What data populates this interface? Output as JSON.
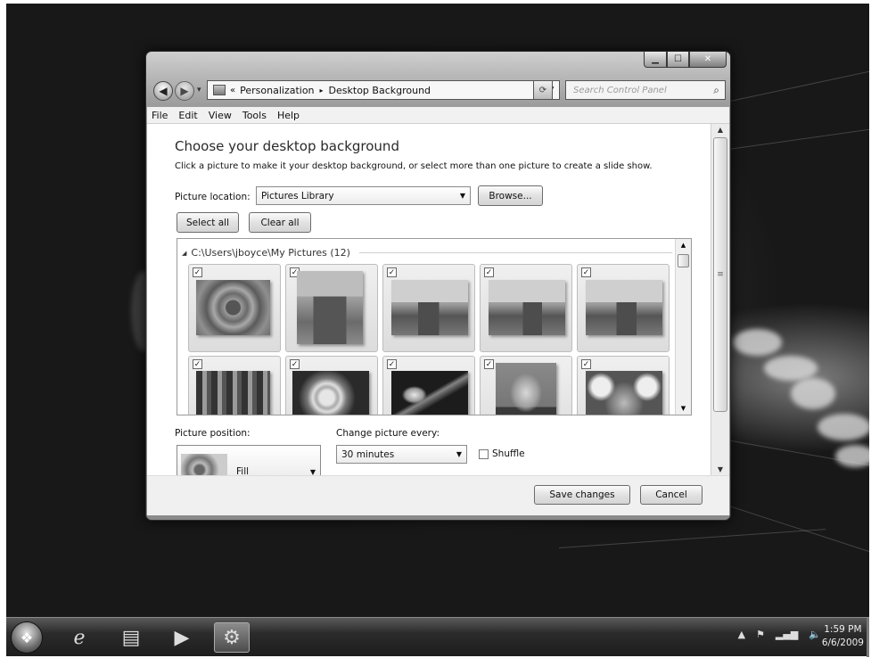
{
  "window": {
    "address": {
      "chevron": "«",
      "crumbs": [
        "Personalization",
        "Desktop Background"
      ],
      "separator": "▸"
    },
    "search_placeholder": "Search Control Panel",
    "menu": [
      "File",
      "Edit",
      "View",
      "Tools",
      "Help"
    ],
    "heading": "Choose your desktop background",
    "subheading": "Click a picture to make it your desktop background, or select more than one picture to create a slide show.",
    "picture_location": {
      "label": "Picture location:",
      "value": "Pictures Library",
      "browse_label": "Browse..."
    },
    "select_all_label": "Select all",
    "clear_all_label": "Clear all",
    "gallery": {
      "group_header": "C:\\Users\\jboyce\\My Pictures (12)",
      "thumbnails": [
        {
          "subject": "flower",
          "checked": true
        },
        {
          "subject": "butte-portrait",
          "checked": true
        },
        {
          "subject": "desert-butte",
          "checked": true
        },
        {
          "subject": "desert-butte",
          "checked": true
        },
        {
          "subject": "desert-butte",
          "checked": true
        },
        {
          "subject": "family-group",
          "checked": true
        },
        {
          "subject": "white-flowers",
          "checked": true
        },
        {
          "subject": "jellyfish",
          "checked": true
        },
        {
          "subject": "man-portrait",
          "checked": true
        },
        {
          "subject": "koala",
          "checked": true
        }
      ],
      "check_mark": "✓"
    },
    "picture_position": {
      "label": "Picture position:",
      "value": "Fill"
    },
    "change_picture": {
      "label": "Change picture every:",
      "value": "30 minutes"
    },
    "shuffle": {
      "label": "Shuffle",
      "checked": false
    },
    "save_label": "Save changes",
    "cancel_label": "Cancel"
  },
  "taskbar": {
    "clock_time": "1:59 PM",
    "clock_date": "6/6/2009",
    "pinned": [
      "internet-explorer",
      "windows-explorer",
      "media-player",
      "control-panel"
    ]
  }
}
